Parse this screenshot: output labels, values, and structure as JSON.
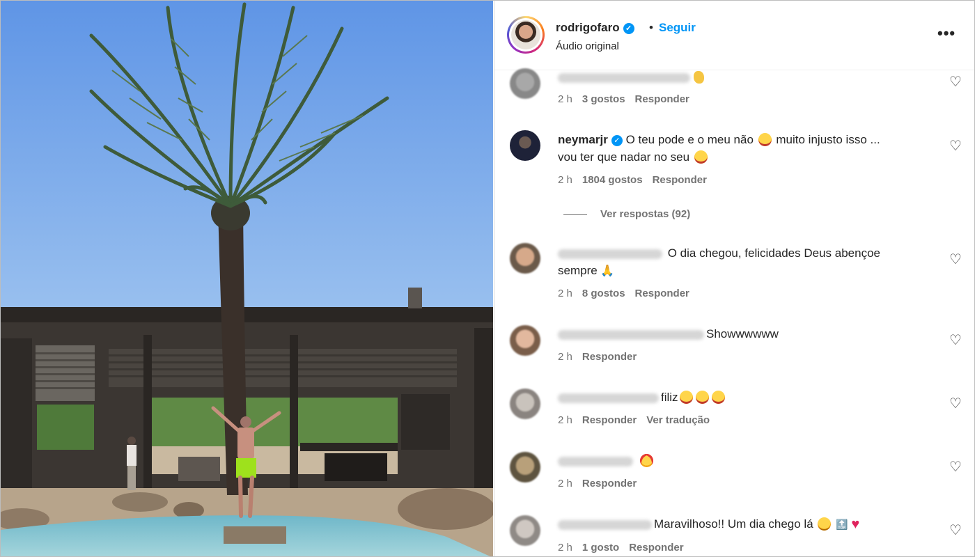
{
  "post": {
    "username": "rodrigofaro",
    "follow_label": "Seguir",
    "audio_label": "Áudio original",
    "more_icon": "more-horizontal-icon"
  },
  "comments": [
    {
      "username": "",
      "text": "",
      "emoji": [
        "clap"
      ],
      "time": "2 h",
      "likes": "3 gostos",
      "reply_label": "Responder"
    },
    {
      "username": "neymarjr",
      "verified": true,
      "text_part1": "O teu pode e o meu não",
      "text_part2": "muito injusto isso ...",
      "text_part3": "vou ter que nadar no seu",
      "time": "2 h",
      "likes": "1804 gostos",
      "reply_label": "Responder",
      "view_replies": "Ver respostas (92)"
    },
    {
      "username": "",
      "text_part1": "O dia chegou, felicidades Deus abençoe",
      "text_part2": "sempre",
      "time": "2 h",
      "likes": "8 gostos",
      "reply_label": "Responder"
    },
    {
      "username": "",
      "text": "Showwwwww",
      "time": "2 h",
      "reply_label": "Responder"
    },
    {
      "username": "",
      "text": "filiz",
      "time": "2 h",
      "reply_label": "Responder",
      "translate_label": "Ver tradução"
    },
    {
      "username": "",
      "text": "",
      "time": "2 h",
      "reply_label": "Responder"
    },
    {
      "username": "",
      "text": "Maravilhoso!! Um dia chego lá",
      "time": "2 h",
      "likes": "1 gosto",
      "reply_label": "Responder"
    }
  ],
  "colors": {
    "accent": "#0095f6",
    "text": "#262626",
    "muted": "#737373",
    "sky": "#6d9fe3"
  }
}
